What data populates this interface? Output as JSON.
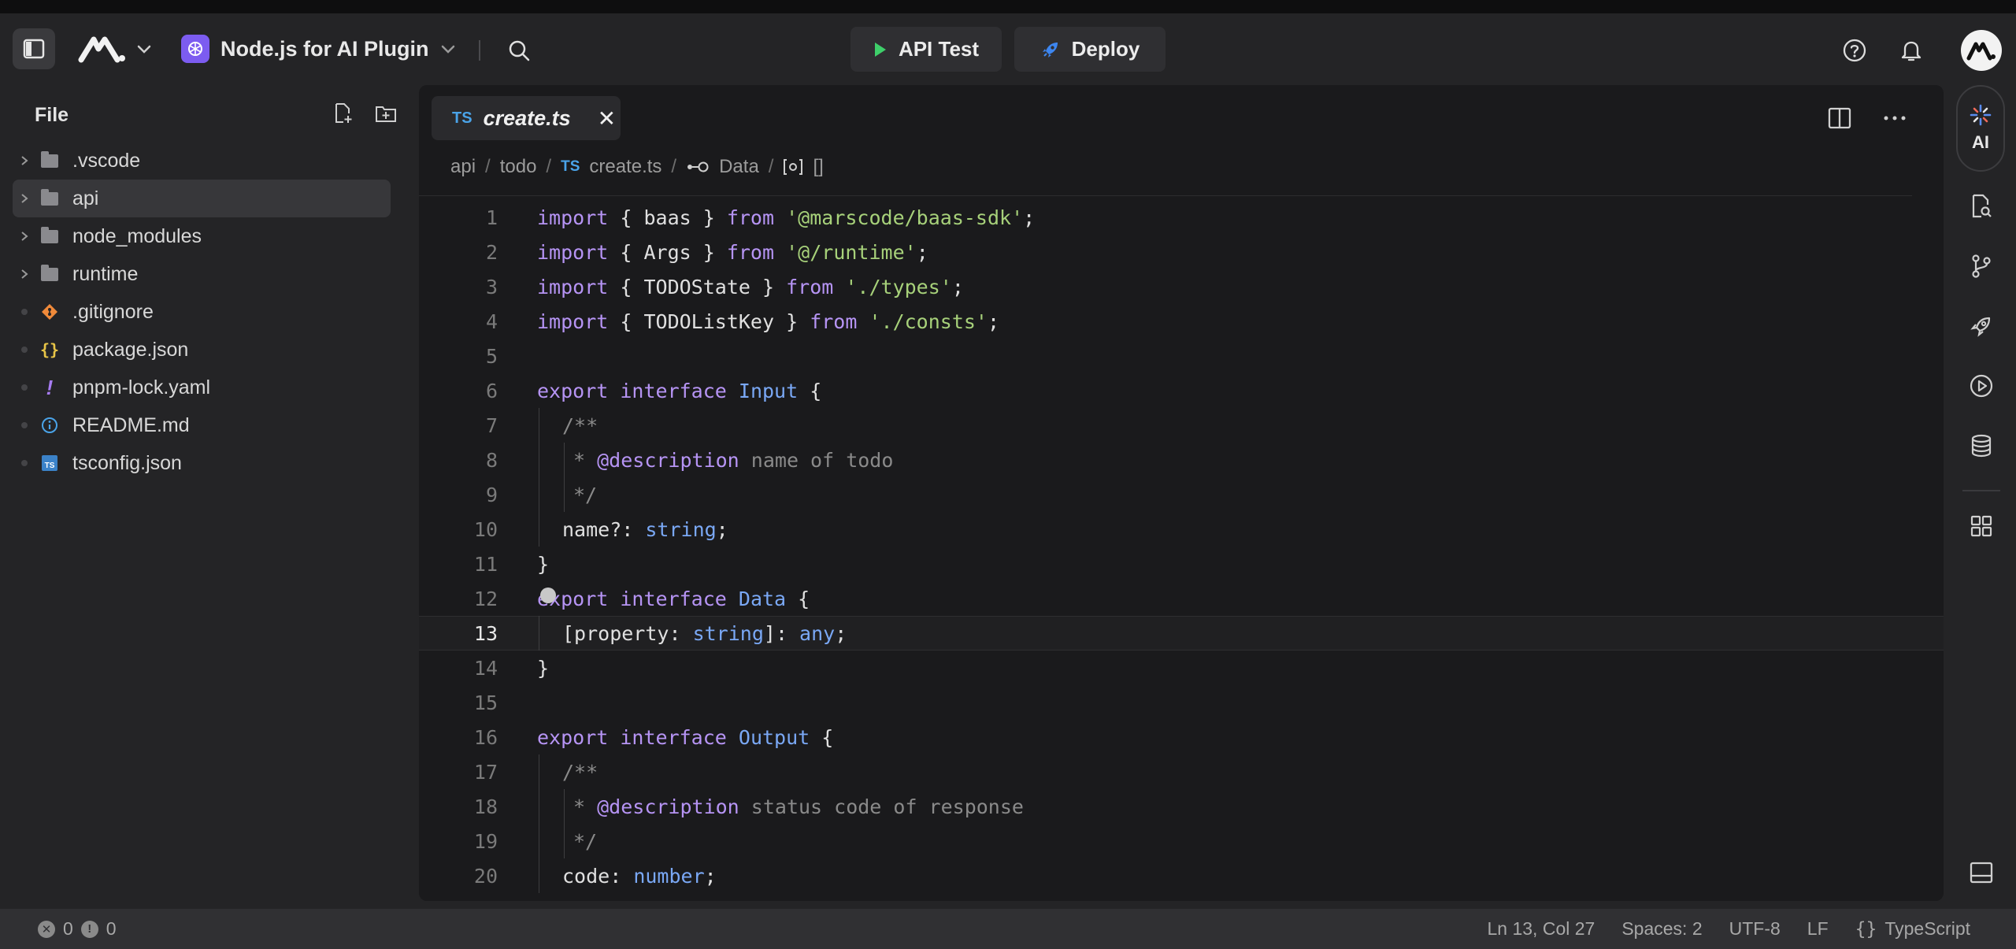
{
  "header": {
    "project_name": "Node.js for AI Plugin",
    "api_test_label": "API Test",
    "deploy_label": "Deploy"
  },
  "sidebar": {
    "title": "File",
    "items": [
      {
        "label": ".vscode",
        "type": "folder"
      },
      {
        "label": "api",
        "type": "folder",
        "selected": true
      },
      {
        "label": "node_modules",
        "type": "folder"
      },
      {
        "label": "runtime",
        "type": "folder"
      },
      {
        "label": ".gitignore",
        "type": "file",
        "icon": "git-icon"
      },
      {
        "label": "package.json",
        "type": "file",
        "icon": "json-icon"
      },
      {
        "label": "pnpm-lock.yaml",
        "type": "file",
        "icon": "yaml-icon"
      },
      {
        "label": "README.md",
        "type": "file",
        "icon": "info-icon"
      },
      {
        "label": "tsconfig.json",
        "type": "file",
        "icon": "ts-icon"
      }
    ]
  },
  "editor": {
    "tab": {
      "badge": "TS",
      "name": "create.ts",
      "close": "✕"
    },
    "breadcrumb": [
      "api",
      "todo",
      "create.ts",
      "Data",
      "[]"
    ],
    "breadcrumb_ts_badge": "TS",
    "current_line": 13
  },
  "code_lines": [
    {
      "n": "1"
    },
    {
      "n": "2"
    },
    {
      "n": "3"
    },
    {
      "n": "4"
    },
    {
      "n": "5"
    },
    {
      "n": "6"
    },
    {
      "n": "7"
    },
    {
      "n": "8"
    },
    {
      "n": "9"
    },
    {
      "n": "10"
    },
    {
      "n": "11"
    },
    {
      "n": "12"
    },
    {
      "n": "13"
    },
    {
      "n": "14"
    },
    {
      "n": "15"
    },
    {
      "n": "16"
    },
    {
      "n": "17"
    },
    {
      "n": "18"
    },
    {
      "n": "19"
    },
    {
      "n": "20"
    }
  ],
  "code": {
    "l1": [
      "import",
      " { baas } ",
      "from",
      " ",
      "'@marscode/baas-sdk'",
      ";"
    ],
    "l2": [
      "import",
      " { Args } ",
      "from",
      " ",
      "'@/runtime'",
      ";"
    ],
    "l3": [
      "import",
      " { TODOState } ",
      "from",
      " ",
      "'./types'",
      ";"
    ],
    "l4": [
      "import",
      " { TODOListKey } ",
      "from",
      " ",
      "'./consts'",
      ";"
    ],
    "l6": [
      "export",
      " ",
      "interface",
      " ",
      "Input",
      " {"
    ],
    "l7": "/**",
    "l8": [
      "* ",
      "@description",
      " name of todo"
    ],
    "l9": "*/",
    "l10": [
      "name?: ",
      "string",
      ";"
    ],
    "l11": "}",
    "l12": [
      "export",
      " ",
      "interface",
      " ",
      "Data",
      " {"
    ],
    "l13": [
      "[property: ",
      "string",
      "]: ",
      "any",
      ";"
    ],
    "l14": "}",
    "l16": [
      "export",
      " ",
      "interface",
      " ",
      "Output",
      " {"
    ],
    "l17": "/**",
    "l18": [
      "* ",
      "@description",
      " status code of response"
    ],
    "l19": "*/",
    "l20": [
      "code: ",
      "number",
      ";"
    ]
  },
  "rail": {
    "ai_label": "AI"
  },
  "status": {
    "errors": "0",
    "warnings": "0",
    "position": "Ln 13, Col 27",
    "spaces": "Spaces: 2",
    "encoding": "UTF-8",
    "eol": "LF",
    "language": "TypeScript"
  },
  "colors": {
    "keyword": "#b694f4",
    "type": "#7aa8f5",
    "string": "#a7d17a",
    "comment": "#8a8a8a",
    "project_icon": "#7c5cf0"
  }
}
